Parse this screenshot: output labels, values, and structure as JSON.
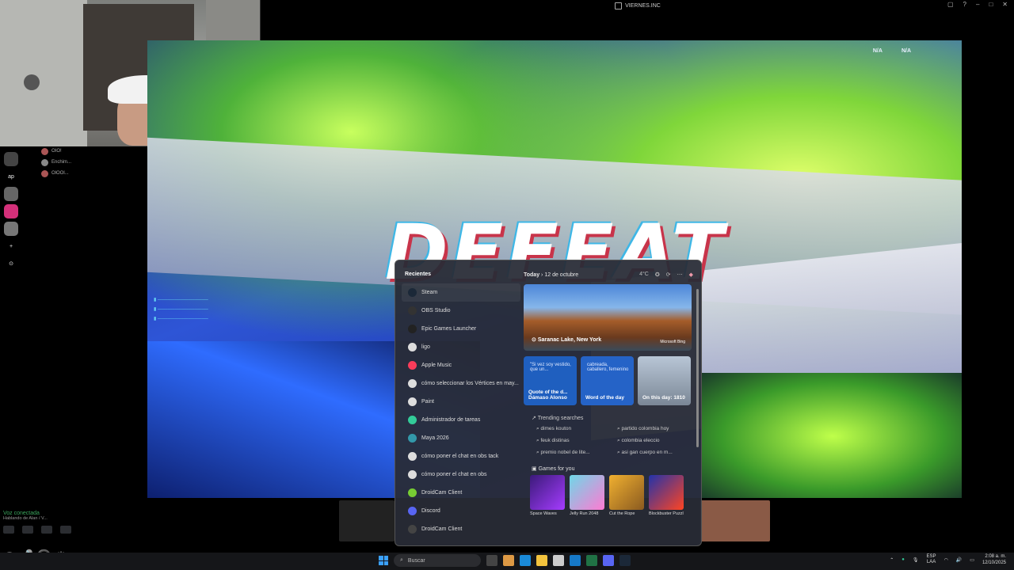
{
  "window": {
    "title": "VIERNES.INC"
  },
  "game": {
    "banner": "DEFEAT",
    "hud": [
      "N/A",
      "N/A"
    ],
    "chat_lines": [
      "▮ ───────────────",
      "▮ ───────────────",
      "▮ ───────────────"
    ]
  },
  "discord": {
    "rail": [
      "ap",
      "+",
      "⊙"
    ],
    "users": [
      "OIO!",
      "Enchim...",
      "OlOOl..."
    ],
    "voice_status": "Voz conectada",
    "voice_sub": "Hablando de Alan / V..."
  },
  "start_menu": {
    "recents_title": "Recientes",
    "recents": [
      {
        "label": "Steam",
        "icon": "steam-icon",
        "color": "#1b2838"
      },
      {
        "label": "OBS Studio",
        "icon": "obs-icon",
        "color": "#333"
      },
      {
        "label": "Epic Games Launcher",
        "icon": "epic-icon",
        "color": "#222"
      },
      {
        "label": "ligo",
        "icon": "app-icon",
        "color": "#ddd"
      },
      {
        "label": "Apple Music",
        "icon": "music-icon",
        "color": "#fa3c5a"
      },
      {
        "label": "cómo seleccionar los Vértices en may...",
        "icon": "web-icon",
        "color": "#ddd"
      },
      {
        "label": "Paint",
        "icon": "paint-icon",
        "color": "#ddd"
      },
      {
        "label": "Administrador de tareas",
        "icon": "taskmgr-icon",
        "color": "#3c9"
      },
      {
        "label": "Maya 2026",
        "icon": "maya-icon",
        "color": "#39a"
      },
      {
        "label": "cómo poner el chat en obs tack",
        "icon": "web-icon",
        "color": "#ddd"
      },
      {
        "label": "cómo poner el chat en obs",
        "icon": "web-icon",
        "color": "#ddd"
      },
      {
        "label": "DroidCam Client",
        "icon": "droidcam-icon",
        "color": "#7c3"
      },
      {
        "label": "Discord",
        "icon": "discord-icon",
        "color": "#5865f2"
      },
      {
        "label": "DroidCam Client",
        "icon": "droidcam-icon",
        "color": "#444"
      }
    ],
    "widgets": {
      "today": "Today",
      "date": "12 de octubre",
      "temp": "4°C",
      "hero_location": "Saranac Lake, New York",
      "hero_brand": "Microsoft Bing",
      "cards": [
        {
          "top": "\"Si vez soy vestido, que un...",
          "bottom": "Quote of the d... Dámaso Alonso"
        },
        {
          "top": "cabreada, caballero, femenino",
          "bottom": "Word of the day"
        },
        {
          "top": "",
          "bottom": "On this day: 1810"
        }
      ],
      "trending_title": "Trending searches",
      "trending": [
        "dimes kouton",
        "partido colombia hoy",
        "feuk distinas",
        "colombia eleccio",
        "premio nobel de lite...",
        "asi gan cuerpo en m..."
      ],
      "games_title": "Games for you",
      "games": [
        "Space Waves",
        "Jelly Run 2048",
        "Cut the Rope",
        "Blockbuster Puzzle"
      ]
    }
  },
  "taskbar": {
    "search_placeholder": "Buscar",
    "lang_top": "ESP",
    "lang_bottom": "LAA",
    "time": "2:08 a. m.",
    "date": "12/10/2025"
  }
}
